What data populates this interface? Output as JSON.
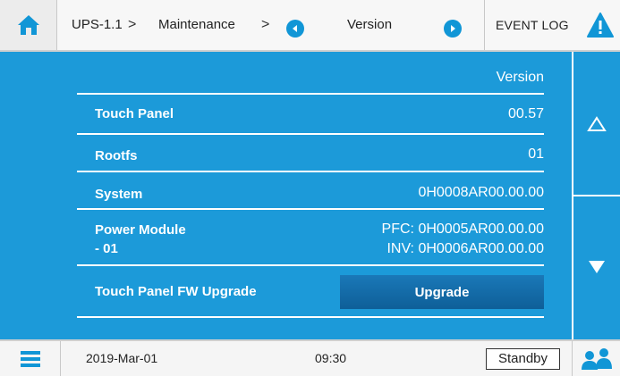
{
  "header": {
    "breadcrumb": [
      "UPS-1.1",
      "Maintenance"
    ],
    "breadcrumb_separator": ">",
    "current_page": "Version",
    "event_log_label": "EVENT LOG"
  },
  "version_table": {
    "column_header": "Version",
    "rows": [
      {
        "label": "Touch Panel",
        "value": "00.57"
      },
      {
        "label": "Rootfs",
        "value": "01"
      },
      {
        "label": "System",
        "value": "0H0008AR00.00.00"
      },
      {
        "label_line1": "Power Module",
        "label_line2": "- 01",
        "value_line1": "PFC: 0H0005AR00.00.00",
        "value_line2": "INV: 0H0006AR00.00.00"
      }
    ],
    "upgrade_label": "Touch Panel FW Upgrade",
    "upgrade_button": "Upgrade"
  },
  "status": {
    "date": "2019-Mar-01",
    "time": "09:30",
    "mode": "Standby"
  },
  "icons": {
    "home": "home-icon",
    "nav_prev": "chevron-left-circle-icon",
    "nav_next": "chevron-right-circle-icon",
    "warning": "warning-icon",
    "scroll_up": "triangle-up-icon",
    "scroll_down": "triangle-down-icon",
    "menu": "menu-icon",
    "users": "users-icon"
  },
  "colors": {
    "panel_blue": "#1c9ad9",
    "accent_blue": "#1196d6",
    "button_blue": "#0e5f98"
  }
}
